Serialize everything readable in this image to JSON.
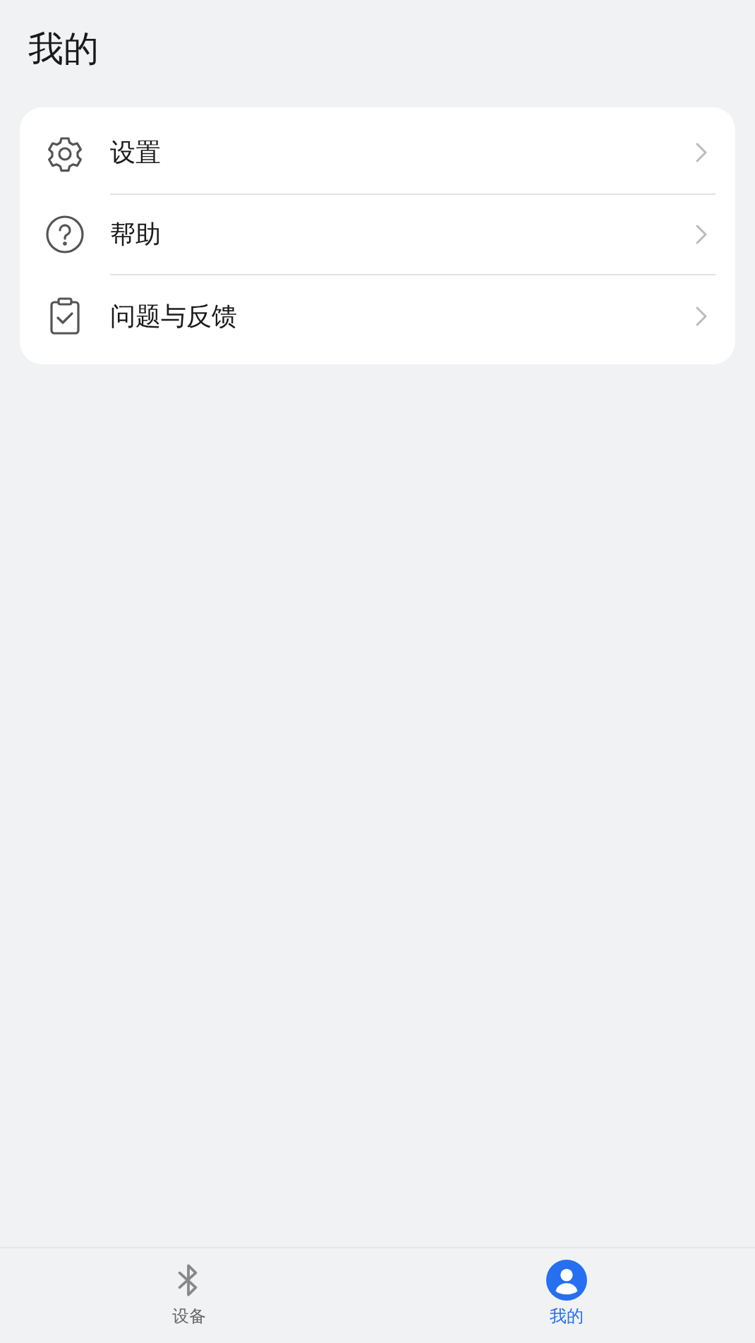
{
  "title": "我的",
  "menu": [
    {
      "kind": "settings",
      "label": "设置"
    },
    {
      "kind": "help",
      "label": "帮助"
    },
    {
      "kind": "feedback",
      "label": "问题与反馈"
    }
  ],
  "tabs": [
    {
      "kind": "bluetooth",
      "label": "设备",
      "selected": false
    },
    {
      "kind": "person",
      "label": "我的",
      "selected": true
    }
  ]
}
